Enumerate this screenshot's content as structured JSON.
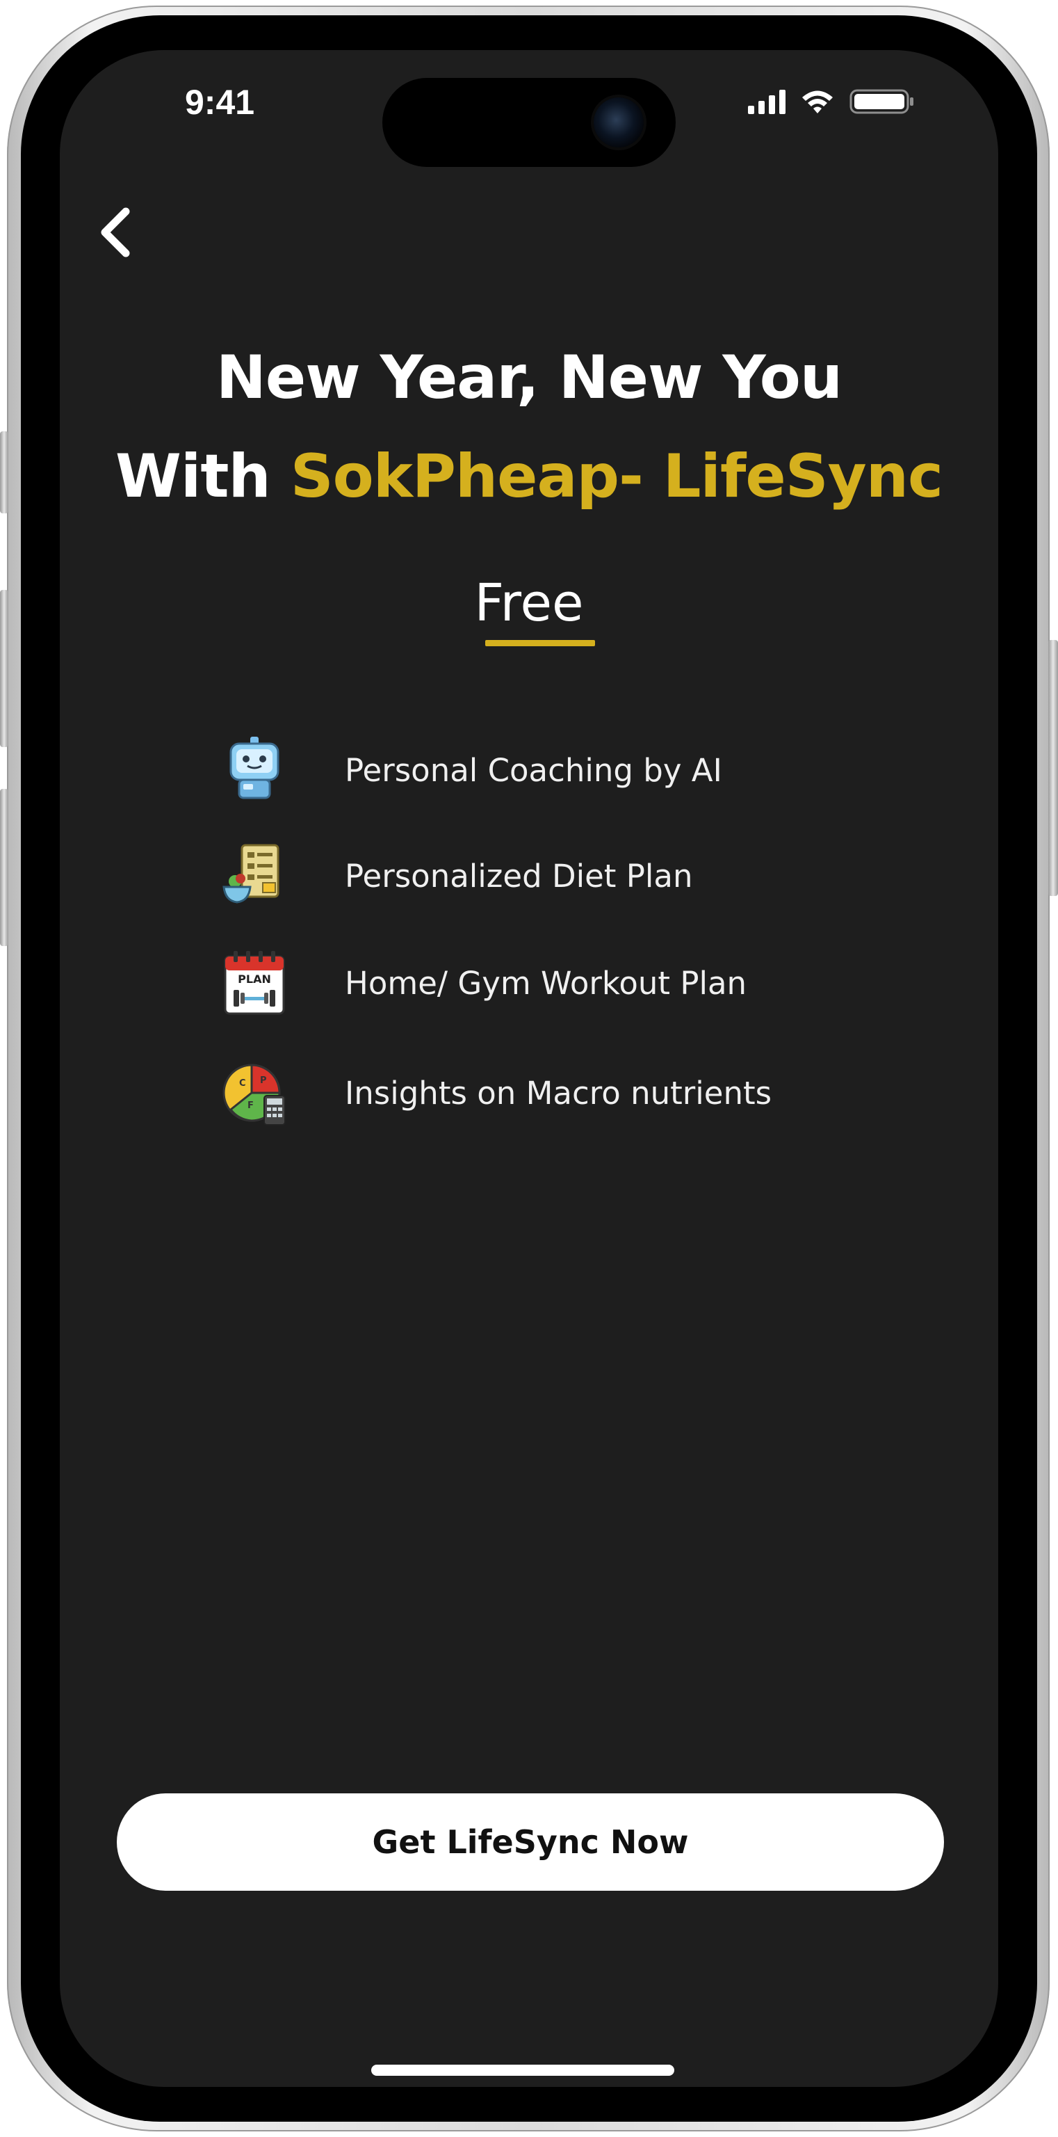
{
  "status_bar": {
    "time": "9:41",
    "icons": [
      "cellular-signal-icon",
      "wifi-icon",
      "battery-icon"
    ]
  },
  "navigation": {
    "back_icon": "chevron-left-icon"
  },
  "headline": {
    "line1": "New Year, New You",
    "line2_prefix": "With",
    "line2_accent": "SokPheap- LifeSync"
  },
  "plan": {
    "tier": "Free"
  },
  "features": [
    {
      "icon": "robot-icon",
      "label": "Personal Coaching by AI"
    },
    {
      "icon": "diet-plan-icon",
      "label": "Personalized Diet Plan"
    },
    {
      "icon": "workout-plan-calendar-icon",
      "label": "Home/ Gym Workout Plan"
    },
    {
      "icon": "macro-nutrients-chart-icon",
      "label": "Insights on Macro nutrients"
    }
  ],
  "cta": {
    "label": "Get LifeSync Now"
  },
  "colors": {
    "background": "#1e1e1e",
    "accent": "#d5b01e",
    "text": "#ffffff",
    "button_bg": "#ffffff",
    "button_text": "#111111"
  }
}
